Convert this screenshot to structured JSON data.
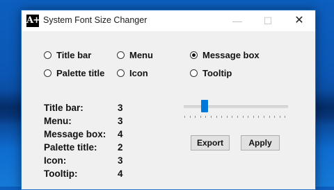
{
  "window": {
    "title": "System Font Size Changer",
    "icon_text": "A+",
    "controls": {
      "minimize": "—",
      "maximize": "☐",
      "close": "✕"
    }
  },
  "radios": [
    {
      "label": "Title bar",
      "selected": false
    },
    {
      "label": "Menu",
      "selected": false
    },
    {
      "label": "Message box",
      "selected": true
    },
    {
      "label": "Palette title",
      "selected": false
    },
    {
      "label": "Icon",
      "selected": false
    },
    {
      "label": "Tooltip",
      "selected": false
    }
  ],
  "stats": [
    {
      "label": "Title bar:",
      "value": "3"
    },
    {
      "label": "Menu:",
      "value": "3"
    },
    {
      "label": "Message box:",
      "value": "4"
    },
    {
      "label": "Palette title:",
      "value": "2"
    },
    {
      "label": "Icon:",
      "value": "3"
    },
    {
      "label": "Tooltip:",
      "value": "4"
    }
  ],
  "slider": {
    "value_fraction": 0.2,
    "accent": "#0078d7"
  },
  "buttons": {
    "export": "Export",
    "apply": "Apply"
  }
}
